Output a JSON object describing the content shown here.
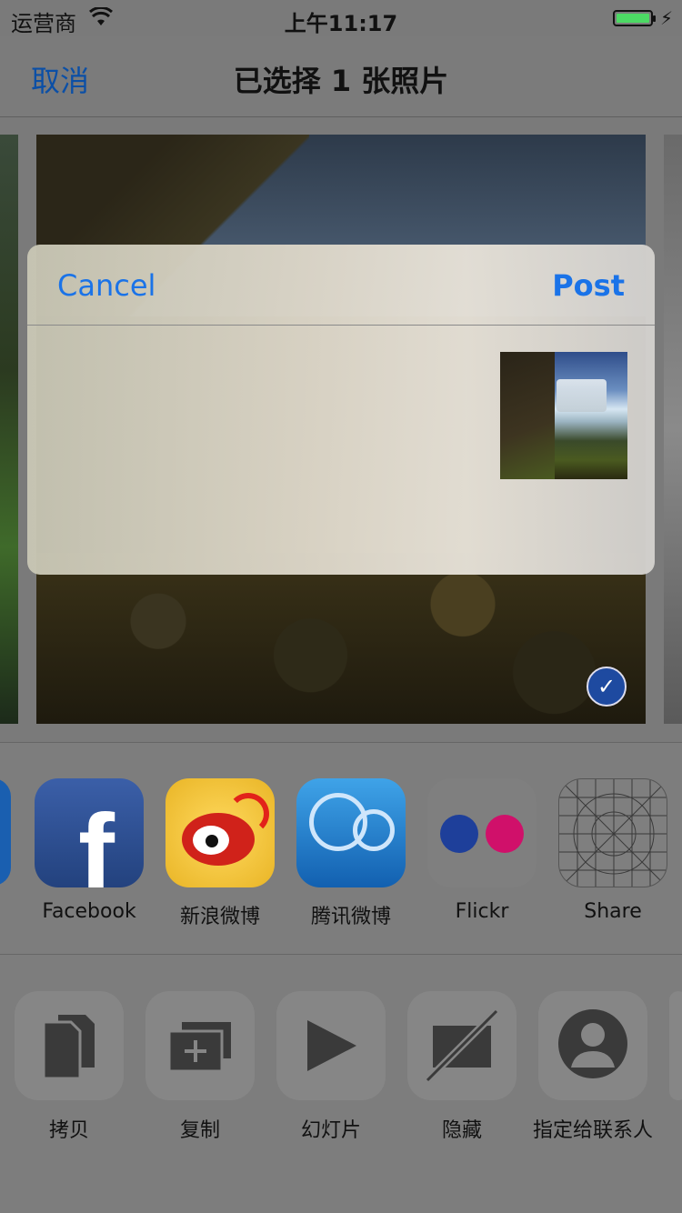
{
  "status_bar": {
    "carrier": "运营商",
    "time": "上午11:17",
    "battery_color": "#4cd964"
  },
  "nav": {
    "cancel": "取消",
    "title": "已选择 1 张照片"
  },
  "compose": {
    "cancel": "Cancel",
    "post": "Post"
  },
  "share_apps": [
    {
      "label": "Facebook",
      "icon": "facebook-icon"
    },
    {
      "label": "新浪微博",
      "icon": "weibo-icon"
    },
    {
      "label": "腾讯微博",
      "icon": "tencent-weibo-icon"
    },
    {
      "label": "Flickr",
      "icon": "flickr-icon"
    },
    {
      "label": "Share",
      "icon": "share-more-icon"
    }
  ],
  "actions": [
    {
      "label": "拷贝",
      "icon": "copy-icon"
    },
    {
      "label": "复制",
      "icon": "duplicate-icon"
    },
    {
      "label": "幻灯片",
      "icon": "slideshow-icon"
    },
    {
      "label": "隐藏",
      "icon": "hide-icon"
    },
    {
      "label": "指定给联系人",
      "icon": "assign-contact-icon"
    }
  ],
  "colors": {
    "link_blue": "#1a73e8",
    "selected_check": "#1e4aa0"
  }
}
